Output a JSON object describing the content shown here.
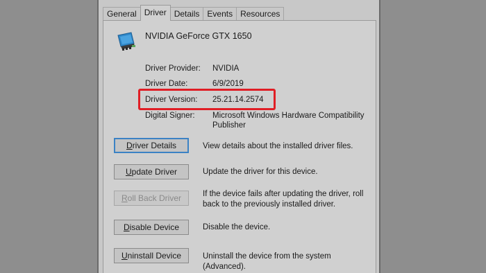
{
  "tabs": [
    "General",
    "Driver",
    "Details",
    "Events",
    "Resources"
  ],
  "active_tab": "Driver",
  "device": {
    "name": "NVIDIA GeForce GTX 1650",
    "icon": "display-adapter-icon"
  },
  "properties": {
    "provider": {
      "label": "Driver Provider:",
      "value": "NVIDIA"
    },
    "date": {
      "label": "Driver Date:",
      "value": "6/9/2019"
    },
    "version": {
      "label": "Driver Version:",
      "value": "25.21.14.2574"
    },
    "signer": {
      "label": "Digital Signer:",
      "value_line1": "Microsoft Windows Hardware Compatibility",
      "value_line2": "Publisher"
    }
  },
  "highlight_color": "#e01e25",
  "buttons": {
    "details": {
      "mn": "D",
      "rest": "river Details",
      "desc": "View details about the installed driver files."
    },
    "update": {
      "mn": "U",
      "rest": "pdate Driver",
      "desc": "Update the driver for this device."
    },
    "rollback": {
      "mn": "R",
      "rest": "oll Back Driver",
      "desc_line1": "If the device fails after updating the driver, roll",
      "desc_line2": "back to the previously installed driver."
    },
    "disable": {
      "mn": "D",
      "rest": "isable Device",
      "desc": "Disable the device."
    },
    "uninstall": {
      "mn": "U",
      "rest": "ninstall Device",
      "desc": "Uninstall the device from the system (Advanced)."
    }
  }
}
